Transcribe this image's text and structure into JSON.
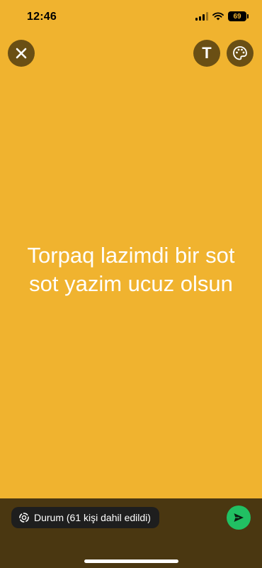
{
  "status_bar": {
    "time": "12:46",
    "battery": "69"
  },
  "toolbar": {
    "close_icon": "close-icon",
    "text_label": "T",
    "palette_icon": "palette-icon"
  },
  "story": {
    "text": "Torpaq lazimdi bir sot sot yazim ucuz olsun",
    "background_color": "#F0B32F",
    "text_color": "#FFFFFF"
  },
  "footer": {
    "audience_icon": "status-ring-icon",
    "audience_label": "Durum (61 kişi dahil edildi)",
    "send_icon": "send-icon",
    "send_color": "#21C063"
  }
}
